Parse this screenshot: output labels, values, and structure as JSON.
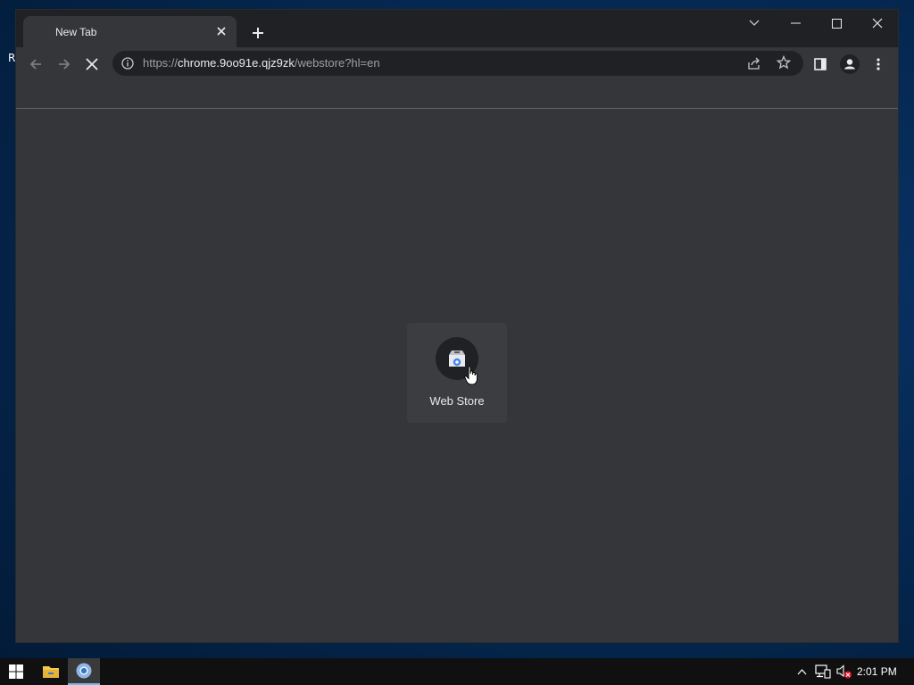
{
  "desktop": {
    "partial_label": "R"
  },
  "browser": {
    "tab": {
      "title": "New Tab"
    },
    "url": {
      "scheme": "https://",
      "host": "chrome.9oo91e.qjz9zk",
      "path": "/webstore?hl=en"
    },
    "shortcut": {
      "label": "Web Store",
      "icon": "web-store-icon"
    }
  },
  "taskbar": {
    "clock": "2:01 PM",
    "accent": "#76b9ed"
  }
}
